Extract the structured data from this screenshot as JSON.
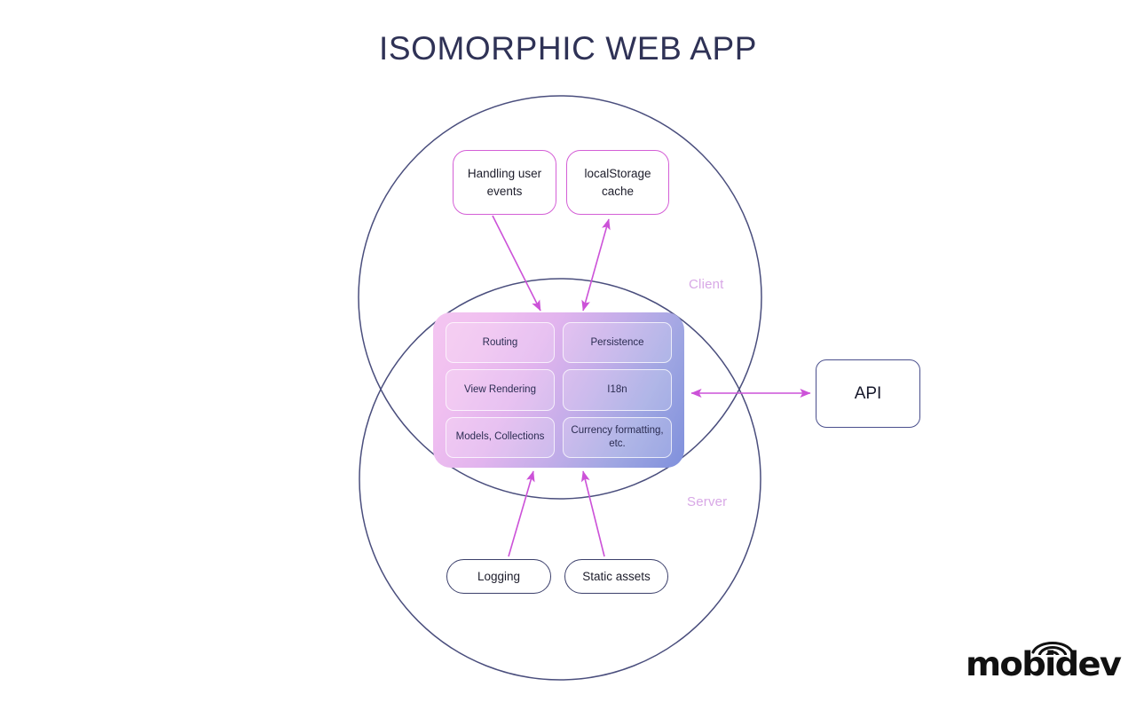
{
  "page": {
    "title": "ISOMORPHIC WEB APP",
    "background_color": "#ffffff"
  },
  "colors": {
    "title_text": "#2f3256",
    "circle_stroke": "#4a4e7d",
    "client_node_border": "#d45fd6",
    "server_node_border": "#3b3f6b",
    "api_node_border": "#4a4f8c",
    "arrow": "#cc52d8",
    "circle_label_text": "#d8a8e6",
    "panel_gradient_start": "#f4c6f1",
    "panel_gradient_end": "#7f90dc",
    "logo": "#111111"
  },
  "circles": {
    "client": {
      "label": "Client"
    },
    "server": {
      "label": "Server"
    }
  },
  "client_nodes": [
    {
      "label": "Handling user events",
      "name": "handling-user-events"
    },
    {
      "label": "localStorage cache",
      "name": "localstorage-cache"
    }
  ],
  "server_nodes": [
    {
      "label": "Logging",
      "name": "logging"
    },
    {
      "label": "Static assets",
      "name": "static-assets"
    }
  ],
  "core_panel": {
    "cells": [
      {
        "label": "Routing",
        "name": "routing"
      },
      {
        "label": "Persistence",
        "name": "persistence"
      },
      {
        "label": "View Rendering",
        "name": "view-rendering"
      },
      {
        "label": "I18n",
        "name": "i18n"
      },
      {
        "label": "Models, Collections",
        "name": "models-collections"
      },
      {
        "label": "Currency formatting, etc.",
        "name": "currency-formatting"
      }
    ]
  },
  "api": {
    "label": "API"
  },
  "connections": [
    {
      "from": "Handling user events",
      "to": "core panel",
      "direction": "one-way"
    },
    {
      "from": "core panel",
      "to": "localStorage cache",
      "direction": "two-way"
    },
    {
      "from": "Logging",
      "to": "core panel",
      "direction": "one-way"
    },
    {
      "from": "Static assets",
      "to": "core panel",
      "direction": "one-way"
    },
    {
      "from": "core panel",
      "to": "API",
      "direction": "two-way"
    }
  ],
  "logo": {
    "text": "mobidev",
    "icon": "wifi-arc-icon"
  }
}
